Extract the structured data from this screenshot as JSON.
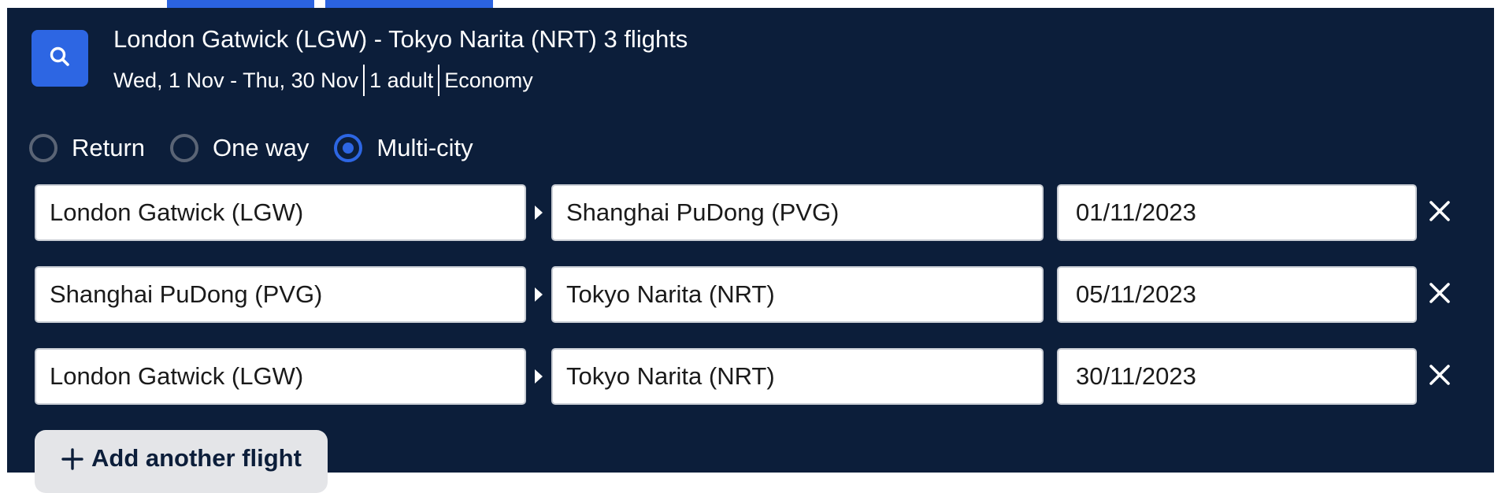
{
  "summary": {
    "title": "London Gatwick (LGW) - Tokyo Narita (NRT) 3 flights",
    "dates": "Wed, 1 Nov - Thu, 30 Nov",
    "passengers": "1 adult",
    "cabin": "Economy"
  },
  "trip_types": [
    {
      "label": "Return",
      "selected": false
    },
    {
      "label": "One way",
      "selected": false
    },
    {
      "label": "Multi-city",
      "selected": true
    }
  ],
  "flights": [
    {
      "from": "London Gatwick (LGW)",
      "to": "Shanghai PuDong (PVG)",
      "date": "01/11/2023"
    },
    {
      "from": "Shanghai PuDong (PVG)",
      "to": "Tokyo Narita (NRT)",
      "date": "05/11/2023"
    },
    {
      "from": "London Gatwick (LGW)",
      "to": "Tokyo Narita (NRT)",
      "date": "30/11/2023"
    }
  ],
  "add_flight_label": "Add another flight",
  "icons": {
    "search": "search-icon",
    "arrow": "arrow-right-icon",
    "remove": "close-icon",
    "add": "plus-icon"
  },
  "colors": {
    "panel_bg": "#0c1e3a",
    "accent": "#2d66e3",
    "add_button_bg": "#e4e5e8"
  }
}
